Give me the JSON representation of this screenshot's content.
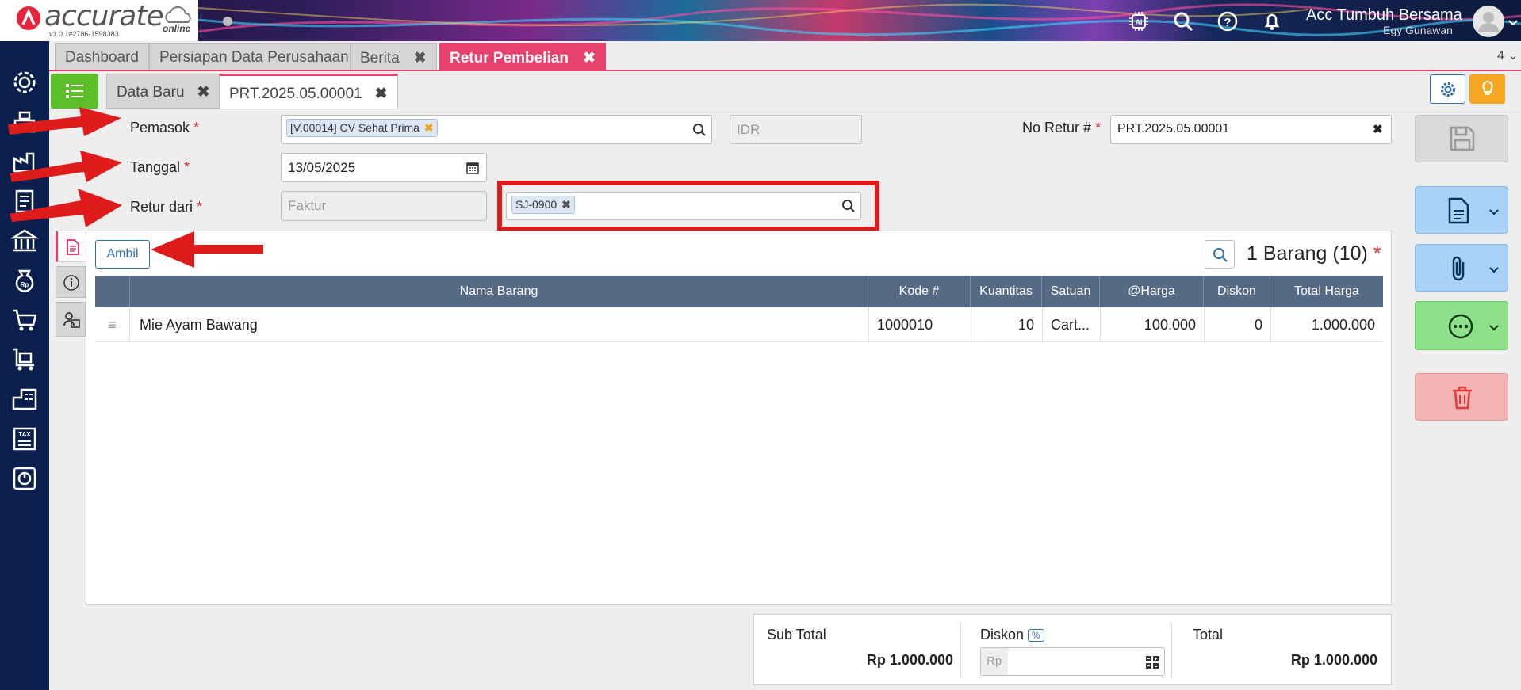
{
  "header": {
    "logo_text": "accurate",
    "logo_sub": "online",
    "version": "v1.0.1#2786-1598383",
    "company": "Acc Tumbuh Bersama",
    "user": "Egy Gunawan",
    "icons": [
      "ai-chip-icon",
      "search-icon",
      "help-icon",
      "bell-icon",
      "avatar-icon"
    ]
  },
  "tabs": [
    {
      "label": "Dashboard",
      "closable": false
    },
    {
      "label": "Persiapan Data Perusahaan",
      "closable": false
    },
    {
      "label": "Berita",
      "closable": true
    },
    {
      "label": "Retur Pembelian",
      "closable": true,
      "active": true
    }
  ],
  "tab_count": "4",
  "subtabs": [
    {
      "label": "Data Baru",
      "closable": true
    },
    {
      "label": "PRT.2025.05.00001",
      "closable": true,
      "active": true
    }
  ],
  "form": {
    "pemasok_label": "Pemasok",
    "pemasok_value": "[V.00014] CV Sehat Prima",
    "currency": "IDR",
    "no_retur_label": "No Retur #",
    "no_retur_value": "PRT.2025.05.00001",
    "tanggal_label": "Tanggal",
    "tanggal_value": "13/05/2025",
    "retur_dari_label": "Retur dari",
    "retur_dari_type": "Faktur",
    "retur_dari_ref": "SJ-0900",
    "required_mark": "*"
  },
  "items": {
    "ambil_label": "Ambil",
    "count_label": "1 Barang (10)",
    "columns": [
      "Nama Barang",
      "Kode #",
      "Kuantitas",
      "Satuan",
      "@Harga",
      "Diskon",
      "Total Harga"
    ],
    "rows": [
      {
        "nama": "Mie Ayam Bawang",
        "kode": "1000010",
        "qty": "10",
        "satuan": "Cart...",
        "harga": "100.000",
        "diskon": "0",
        "total": "1.000.000"
      }
    ]
  },
  "summary": {
    "subtotal_label": "Sub Total",
    "subtotal_value": "Rp 1.000.000",
    "diskon_label": "Diskon",
    "diskon_pct": "%",
    "diskon_prefix": "Rp",
    "total_label": "Total",
    "total_value": "Rp 1.000.000"
  },
  "colors": {
    "accent_pink": "#e8416e",
    "sidebar": "#0b1f4e",
    "table_header": "#566a86",
    "annotation_red": "#e01b1b"
  }
}
